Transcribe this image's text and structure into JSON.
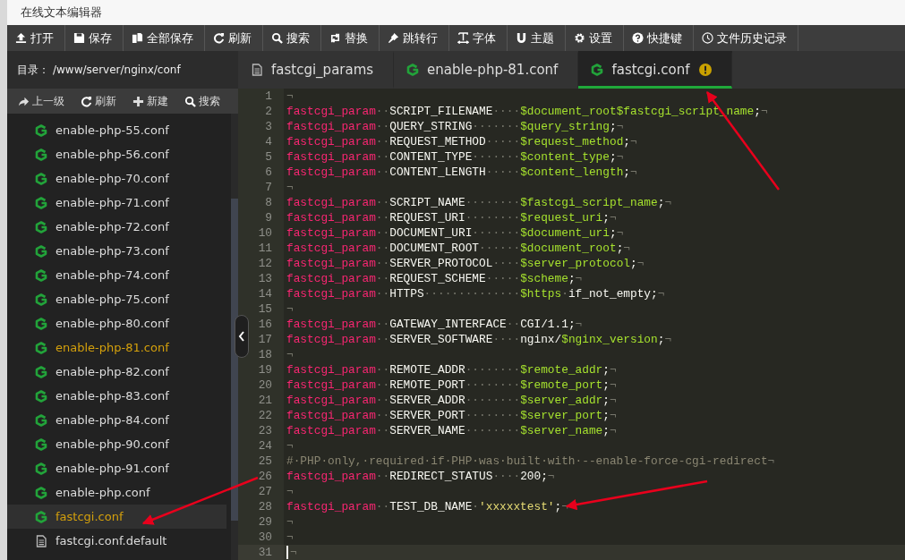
{
  "window": {
    "title": "在线文本编辑器"
  },
  "toolbar": [
    {
      "label": "打开",
      "kind": "upload"
    },
    {
      "label": "保存",
      "kind": "save"
    },
    {
      "label": "全部保存",
      "kind": "copy"
    },
    {
      "label": "刷新",
      "kind": "refresh"
    },
    {
      "label": "搜索",
      "kind": "search"
    },
    {
      "label": "替换",
      "kind": "swap"
    },
    {
      "label": "跳转行",
      "kind": "pin"
    },
    {
      "label": "字体",
      "kind": "text"
    },
    {
      "label": "主题",
      "kind": "magnet"
    },
    {
      "label": "设置",
      "kind": "gear"
    },
    {
      "label": "快捷键",
      "kind": "help"
    },
    {
      "label": "文件历史记录",
      "kind": "clock"
    }
  ],
  "sidebar": {
    "directory_label": "目录：",
    "directory_path": "/www/server/nginx/conf",
    "actions": [
      {
        "label": "上一级",
        "kind": "share"
      },
      {
        "label": "刷新",
        "kind": "refresh"
      },
      {
        "label": "新建",
        "kind": "plus"
      },
      {
        "label": "搜索",
        "kind": "search"
      }
    ],
    "items": [
      {
        "name": "enable-php-55.conf",
        "kind": "nginx",
        "open": false,
        "selected": false
      },
      {
        "name": "enable-php-56.conf",
        "kind": "nginx",
        "open": false,
        "selected": false
      },
      {
        "name": "enable-php-70.conf",
        "kind": "nginx",
        "open": false,
        "selected": false
      },
      {
        "name": "enable-php-71.conf",
        "kind": "nginx",
        "open": false,
        "selected": false
      },
      {
        "name": "enable-php-72.conf",
        "kind": "nginx",
        "open": false,
        "selected": false
      },
      {
        "name": "enable-php-73.conf",
        "kind": "nginx",
        "open": false,
        "selected": false
      },
      {
        "name": "enable-php-74.conf",
        "kind": "nginx",
        "open": false,
        "selected": false
      },
      {
        "name": "enable-php-75.conf",
        "kind": "nginx",
        "open": false,
        "selected": false
      },
      {
        "name": "enable-php-80.conf",
        "kind": "nginx",
        "open": false,
        "selected": false
      },
      {
        "name": "enable-php-81.conf",
        "kind": "nginx",
        "open": true,
        "selected": false
      },
      {
        "name": "enable-php-82.conf",
        "kind": "nginx",
        "open": false,
        "selected": false
      },
      {
        "name": "enable-php-83.conf",
        "kind": "nginx",
        "open": false,
        "selected": false
      },
      {
        "name": "enable-php-84.conf",
        "kind": "nginx",
        "open": false,
        "selected": false
      },
      {
        "name": "enable-php-90.conf",
        "kind": "nginx",
        "open": false,
        "selected": false
      },
      {
        "name": "enable-php-91.conf",
        "kind": "nginx",
        "open": false,
        "selected": false
      },
      {
        "name": "enable-php.conf",
        "kind": "nginx",
        "open": false,
        "selected": false
      },
      {
        "name": "fastcgi.conf",
        "kind": "nginx",
        "open": true,
        "selected": true
      },
      {
        "name": "fastcgi.conf.default",
        "kind": "file",
        "open": false,
        "selected": false
      }
    ]
  },
  "tabs": [
    {
      "label": "fastcgi_params",
      "kind": "file",
      "selected": false,
      "modified": false
    },
    {
      "label": "enable-php-81.conf",
      "kind": "nginx",
      "selected": false,
      "modified": false
    },
    {
      "label": "fastcgi.conf",
      "kind": "nginx",
      "selected": true,
      "modified": true
    }
  ],
  "editor": {
    "lines": [
      {
        "n": "1",
        "current": false,
        "tokens": [
          {
            "kind": "ws",
            "text": "¬"
          }
        ]
      },
      {
        "n": "2",
        "current": false,
        "tokens": [
          {
            "kind": "kw",
            "text": "fastcgi_param"
          },
          {
            "kind": "ws",
            "text": "··"
          },
          {
            "kind": "name",
            "text": "SCRIPT_FILENAME"
          },
          {
            "kind": "ws",
            "text": "····"
          },
          {
            "kind": "var",
            "text": "$document_root$fastcgi_script_name"
          },
          {
            "kind": "plain",
            "text": ";"
          },
          {
            "kind": "ws",
            "text": "¬"
          }
        ]
      },
      {
        "n": "3",
        "current": false,
        "tokens": [
          {
            "kind": "kw",
            "text": "fastcgi_param"
          },
          {
            "kind": "ws",
            "text": "··"
          },
          {
            "kind": "name",
            "text": "QUERY_STRING"
          },
          {
            "kind": "ws",
            "text": "·······"
          },
          {
            "kind": "var",
            "text": "$query_string"
          },
          {
            "kind": "plain",
            "text": ";"
          },
          {
            "kind": "ws",
            "text": "¬"
          }
        ]
      },
      {
        "n": "4",
        "current": false,
        "tokens": [
          {
            "kind": "kw",
            "text": "fastcgi_param"
          },
          {
            "kind": "ws",
            "text": "··"
          },
          {
            "kind": "name",
            "text": "REQUEST_METHOD"
          },
          {
            "kind": "ws",
            "text": "·····"
          },
          {
            "kind": "var",
            "text": "$request_method"
          },
          {
            "kind": "plain",
            "text": ";"
          },
          {
            "kind": "ws",
            "text": "¬"
          }
        ]
      },
      {
        "n": "5",
        "current": false,
        "tokens": [
          {
            "kind": "kw",
            "text": "fastcgi_param"
          },
          {
            "kind": "ws",
            "text": "··"
          },
          {
            "kind": "name",
            "text": "CONTENT_TYPE"
          },
          {
            "kind": "ws",
            "text": "·······"
          },
          {
            "kind": "var",
            "text": "$content_type"
          },
          {
            "kind": "plain",
            "text": ";"
          },
          {
            "kind": "ws",
            "text": "¬"
          }
        ]
      },
      {
        "n": "6",
        "current": false,
        "tokens": [
          {
            "kind": "kw",
            "text": "fastcgi_param"
          },
          {
            "kind": "ws",
            "text": "··"
          },
          {
            "kind": "name",
            "text": "CONTENT_LENGTH"
          },
          {
            "kind": "ws",
            "text": "·····"
          },
          {
            "kind": "var",
            "text": "$content_length"
          },
          {
            "kind": "plain",
            "text": ";"
          },
          {
            "kind": "ws",
            "text": "¬"
          }
        ]
      },
      {
        "n": "7",
        "current": false,
        "tokens": [
          {
            "kind": "ws",
            "text": "¬"
          }
        ]
      },
      {
        "n": "8",
        "current": false,
        "tokens": [
          {
            "kind": "kw",
            "text": "fastcgi_param"
          },
          {
            "kind": "ws",
            "text": "··"
          },
          {
            "kind": "name",
            "text": "SCRIPT_NAME"
          },
          {
            "kind": "ws",
            "text": "········"
          },
          {
            "kind": "var",
            "text": "$fastcgi_script_name"
          },
          {
            "kind": "plain",
            "text": ";"
          },
          {
            "kind": "ws",
            "text": "¬"
          }
        ]
      },
      {
        "n": "9",
        "current": false,
        "tokens": [
          {
            "kind": "kw",
            "text": "fastcgi_param"
          },
          {
            "kind": "ws",
            "text": "··"
          },
          {
            "kind": "name",
            "text": "REQUEST_URI"
          },
          {
            "kind": "ws",
            "text": "········"
          },
          {
            "kind": "var",
            "text": "$request_uri"
          },
          {
            "kind": "plain",
            "text": ";"
          },
          {
            "kind": "ws",
            "text": "¬"
          }
        ]
      },
      {
        "n": "10",
        "current": false,
        "tokens": [
          {
            "kind": "kw",
            "text": "fastcgi_param"
          },
          {
            "kind": "ws",
            "text": "··"
          },
          {
            "kind": "name",
            "text": "DOCUMENT_URI"
          },
          {
            "kind": "ws",
            "text": "·······"
          },
          {
            "kind": "var",
            "text": "$document_uri"
          },
          {
            "kind": "plain",
            "text": ";"
          },
          {
            "kind": "ws",
            "text": "¬"
          }
        ]
      },
      {
        "n": "11",
        "current": false,
        "tokens": [
          {
            "kind": "kw",
            "text": "fastcgi_param"
          },
          {
            "kind": "ws",
            "text": "··"
          },
          {
            "kind": "name",
            "text": "DOCUMENT_ROOT"
          },
          {
            "kind": "ws",
            "text": "······"
          },
          {
            "kind": "var",
            "text": "$document_root"
          },
          {
            "kind": "plain",
            "text": ";"
          },
          {
            "kind": "ws",
            "text": "¬"
          }
        ]
      },
      {
        "n": "12",
        "current": false,
        "tokens": [
          {
            "kind": "kw",
            "text": "fastcgi_param"
          },
          {
            "kind": "ws",
            "text": "··"
          },
          {
            "kind": "name",
            "text": "SERVER_PROTOCOL"
          },
          {
            "kind": "ws",
            "text": "····"
          },
          {
            "kind": "var",
            "text": "$server_protocol"
          },
          {
            "kind": "plain",
            "text": ";"
          },
          {
            "kind": "ws",
            "text": "¬"
          }
        ]
      },
      {
        "n": "13",
        "current": false,
        "tokens": [
          {
            "kind": "kw",
            "text": "fastcgi_param"
          },
          {
            "kind": "ws",
            "text": "··"
          },
          {
            "kind": "name",
            "text": "REQUEST_SCHEME"
          },
          {
            "kind": "ws",
            "text": "·····"
          },
          {
            "kind": "var",
            "text": "$scheme"
          },
          {
            "kind": "plain",
            "text": ";"
          },
          {
            "kind": "ws",
            "text": "¬"
          }
        ]
      },
      {
        "n": "14",
        "current": false,
        "tokens": [
          {
            "kind": "kw",
            "text": "fastcgi_param"
          },
          {
            "kind": "ws",
            "text": "··"
          },
          {
            "kind": "name",
            "text": "HTTPS"
          },
          {
            "kind": "ws",
            "text": "··············"
          },
          {
            "kind": "var",
            "text": "$https"
          },
          {
            "kind": "ws",
            "text": "·"
          },
          {
            "kind": "plain",
            "text": "if_not_empty;"
          },
          {
            "kind": "ws",
            "text": "¬"
          }
        ]
      },
      {
        "n": "15",
        "current": false,
        "tokens": [
          {
            "kind": "ws",
            "text": "¬"
          }
        ]
      },
      {
        "n": "16",
        "current": false,
        "tokens": [
          {
            "kind": "kw",
            "text": "fastcgi_param"
          },
          {
            "kind": "ws",
            "text": "··"
          },
          {
            "kind": "name",
            "text": "GATEWAY_INTERFACE"
          },
          {
            "kind": "ws",
            "text": "··"
          },
          {
            "kind": "plain",
            "text": "CGI/1.1;"
          },
          {
            "kind": "ws",
            "text": "¬"
          }
        ]
      },
      {
        "n": "17",
        "current": false,
        "tokens": [
          {
            "kind": "kw",
            "text": "fastcgi_param"
          },
          {
            "kind": "ws",
            "text": "··"
          },
          {
            "kind": "name",
            "text": "SERVER_SOFTWARE"
          },
          {
            "kind": "ws",
            "text": "····"
          },
          {
            "kind": "plain",
            "text": "nginx/"
          },
          {
            "kind": "var",
            "text": "$nginx_version"
          },
          {
            "kind": "plain",
            "text": ";"
          },
          {
            "kind": "ws",
            "text": "¬"
          }
        ]
      },
      {
        "n": "18",
        "current": false,
        "tokens": [
          {
            "kind": "ws",
            "text": "¬"
          }
        ]
      },
      {
        "n": "19",
        "current": false,
        "tokens": [
          {
            "kind": "kw",
            "text": "fastcgi_param"
          },
          {
            "kind": "ws",
            "text": "··"
          },
          {
            "kind": "name",
            "text": "REMOTE_ADDR"
          },
          {
            "kind": "ws",
            "text": "········"
          },
          {
            "kind": "var",
            "text": "$remote_addr"
          },
          {
            "kind": "plain",
            "text": ";"
          },
          {
            "kind": "ws",
            "text": "¬"
          }
        ]
      },
      {
        "n": "20",
        "current": false,
        "tokens": [
          {
            "kind": "kw",
            "text": "fastcgi_param"
          },
          {
            "kind": "ws",
            "text": "··"
          },
          {
            "kind": "name",
            "text": "REMOTE_PORT"
          },
          {
            "kind": "ws",
            "text": "········"
          },
          {
            "kind": "var",
            "text": "$remote_port"
          },
          {
            "kind": "plain",
            "text": ";"
          },
          {
            "kind": "ws",
            "text": "¬"
          }
        ]
      },
      {
        "n": "21",
        "current": false,
        "tokens": [
          {
            "kind": "kw",
            "text": "fastcgi_param"
          },
          {
            "kind": "ws",
            "text": "··"
          },
          {
            "kind": "name",
            "text": "SERVER_ADDR"
          },
          {
            "kind": "ws",
            "text": "········"
          },
          {
            "kind": "var",
            "text": "$server_addr"
          },
          {
            "kind": "plain",
            "text": ";"
          },
          {
            "kind": "ws",
            "text": "¬"
          }
        ]
      },
      {
        "n": "22",
        "current": false,
        "tokens": [
          {
            "kind": "kw",
            "text": "fastcgi_param"
          },
          {
            "kind": "ws",
            "text": "··"
          },
          {
            "kind": "name",
            "text": "SERVER_PORT"
          },
          {
            "kind": "ws",
            "text": "········"
          },
          {
            "kind": "var",
            "text": "$server_port"
          },
          {
            "kind": "plain",
            "text": ";"
          },
          {
            "kind": "ws",
            "text": "¬"
          }
        ]
      },
      {
        "n": "23",
        "current": false,
        "tokens": [
          {
            "kind": "kw",
            "text": "fastcgi_param"
          },
          {
            "kind": "ws",
            "text": "··"
          },
          {
            "kind": "name",
            "text": "SERVER_NAME"
          },
          {
            "kind": "ws",
            "text": "········"
          },
          {
            "kind": "var",
            "text": "$server_name"
          },
          {
            "kind": "plain",
            "text": ";"
          },
          {
            "kind": "ws",
            "text": "¬"
          }
        ]
      },
      {
        "n": "24",
        "current": false,
        "tokens": [
          {
            "kind": "ws",
            "text": "¬"
          }
        ]
      },
      {
        "n": "25",
        "current": false,
        "tokens": [
          {
            "kind": "comment",
            "text": "#·PHP·only,·required·if·PHP·was·built·with·--enable-force-cgi-redirect"
          },
          {
            "kind": "ws",
            "text": "¬"
          }
        ]
      },
      {
        "n": "26",
        "current": false,
        "tokens": [
          {
            "kind": "kw",
            "text": "fastcgi_param"
          },
          {
            "kind": "ws",
            "text": "··"
          },
          {
            "kind": "name",
            "text": "REDIRECT_STATUS"
          },
          {
            "kind": "ws",
            "text": "····"
          },
          {
            "kind": "plain",
            "text": "200;"
          },
          {
            "kind": "ws",
            "text": "¬"
          }
        ]
      },
      {
        "n": "27",
        "current": false,
        "tokens": [
          {
            "kind": "ws",
            "text": "¬"
          }
        ]
      },
      {
        "n": "28",
        "current": false,
        "tokens": [
          {
            "kind": "kw",
            "text": "fastcgi_param"
          },
          {
            "kind": "ws",
            "text": "··"
          },
          {
            "kind": "name",
            "text": "TEST_DB_NAME"
          },
          {
            "kind": "ws",
            "text": "·"
          },
          {
            "kind": "str",
            "text": "'xxxxxtest'"
          },
          {
            "kind": "plain",
            "text": ";"
          },
          {
            "kind": "ws",
            "text": "¬"
          }
        ]
      },
      {
        "n": "29",
        "current": false,
        "tokens": [
          {
            "kind": "ws",
            "text": "¬"
          }
        ]
      },
      {
        "n": "30",
        "current": false,
        "tokens": [
          {
            "kind": "ws",
            "text": "¬"
          }
        ]
      },
      {
        "n": "31",
        "current": true,
        "tokens": [
          {
            "kind": "ws",
            "text": "¬"
          }
        ]
      }
    ]
  }
}
